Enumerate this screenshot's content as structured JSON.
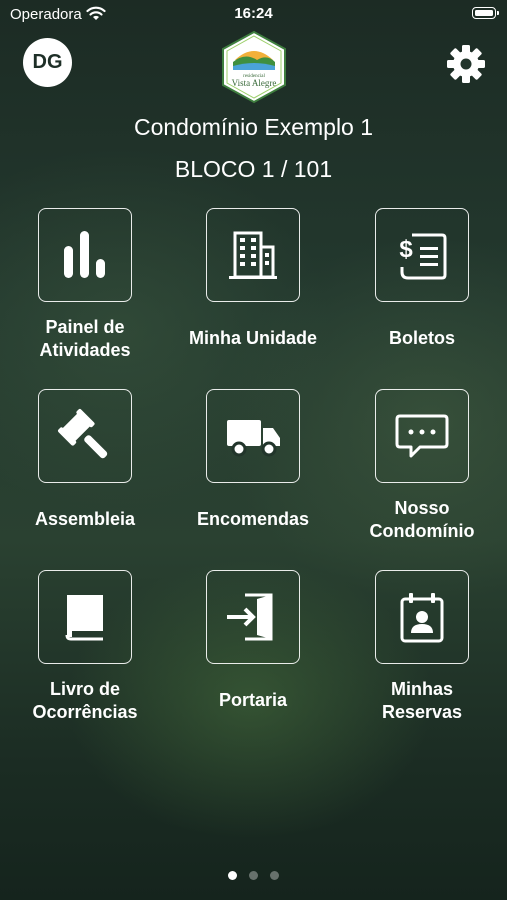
{
  "status_bar": {
    "carrier": "Operadora",
    "time": "16:24"
  },
  "header": {
    "avatar_initials": "DG",
    "logo_text_1": "Vista Alegre",
    "condo_name": "Condomínio Exemplo 1",
    "unit": "BLOCO 1 / 101"
  },
  "menu": [
    {
      "id": "painel",
      "label_line1": "Painel de",
      "label_line2": "Atividades",
      "icon": "bar-chart-icon"
    },
    {
      "id": "minha-unidade",
      "label_line1": "Minha Unidade",
      "label_line2": "",
      "icon": "building-icon"
    },
    {
      "id": "boletos",
      "label_line1": "Boletos",
      "label_line2": "",
      "icon": "invoice-icon"
    },
    {
      "id": "assembleia",
      "label_line1": "Assembleia",
      "label_line2": "",
      "icon": "gavel-icon"
    },
    {
      "id": "encomendas",
      "label_line1": "Encomendas",
      "label_line2": "",
      "icon": "truck-icon"
    },
    {
      "id": "nosso-condominio",
      "label_line1": "Nosso",
      "label_line2": "Condomínio",
      "icon": "chat-icon"
    },
    {
      "id": "livro-ocorrencias",
      "label_line1": "Livro de",
      "label_line2": "Ocorrências",
      "icon": "book-icon"
    },
    {
      "id": "portaria",
      "label_line1": "Portaria",
      "label_line2": "",
      "icon": "door-enter-icon"
    },
    {
      "id": "minhas-reservas",
      "label_line1": "Minhas",
      "label_line2": "Reservas",
      "icon": "calendar-person-icon"
    }
  ],
  "pager": {
    "pages": 3,
    "current": 1
  }
}
